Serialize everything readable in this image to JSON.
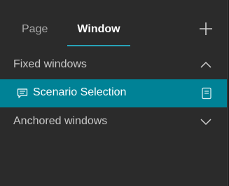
{
  "tabs": {
    "page_label": "Page",
    "window_label": "Window",
    "active": "Window",
    "add_icon": "plus-icon"
  },
  "sections": {
    "fixed": {
      "label": "Fixed windows",
      "expanded": true,
      "chevron_icon": "chevron-up-icon",
      "items": [
        {
          "label": "Scenario Selection",
          "selected": true,
          "icon": "message-icon",
          "action_icon": "page-icon"
        }
      ]
    },
    "anchored": {
      "label": "Anchored windows",
      "expanded": false,
      "chevron_icon": "chevron-down-icon"
    }
  },
  "colors": {
    "background": "#2b2b2b",
    "accent": "#008296",
    "tab_underline": "#27a3b8",
    "text": "#c7c7c7"
  }
}
